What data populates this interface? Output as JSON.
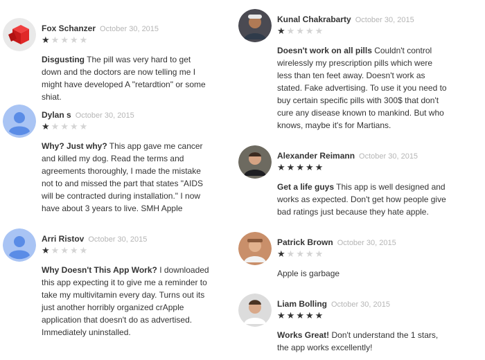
{
  "colors": {
    "star_filled": "#333333",
    "star_empty": "#d4d4d4",
    "date": "#b5b5b5",
    "default_avatar": "#5a8ce6",
    "default_avatar_bg": "#a9c4f4"
  },
  "reviews": [
    {
      "author": "Fox Schanzer",
      "date": "October 30, 2015",
      "rating": 1,
      "title": "Disgusting",
      "text": "The pill was very hard to get down and the doctors are now telling me I might have developed A \"retardtion\" or some shiat.",
      "avatar": "red-cube-avatar"
    },
    {
      "author": "Dylan s",
      "date": "October 30, 2015",
      "rating": 1,
      "title": "Why? Just why?",
      "text": "This app gave me cancer and killed my dog. Read the terms and agreements thoroughly, I made the mistake not to and missed the part that states \"AIDS will be contracted during installation.\" I now have about 3 years to live. SMH Apple",
      "avatar": "default-person-icon"
    },
    {
      "author": "Arri Ristov",
      "date": "October 30, 2015",
      "rating": 1,
      "title": "Why Doesn't This App Work?",
      "text": "I downloaded this app expecting it to give me a reminder to take my multivitamin every day. Turns out its just another horribly organized crApple application that doesn't do as advertised. Immediately uninstalled.",
      "avatar": "default-person-icon"
    },
    {
      "author": "Kunal Chakrabarty",
      "date": "October 30, 2015",
      "rating": 1,
      "title": "Doesn't work on all pills",
      "text": "Couldn't control wirelessly my prescription pills which were less than ten feet away. Doesn't work as stated. Fake advertising. To use it you need to buy certain specific pills with 300$ that don't cure any disease known to mankind. But who knows, maybe it's for Martians.",
      "avatar": "photo-avatar"
    },
    {
      "author": "Alexander Reimann",
      "date": "October 30, 2015",
      "rating": 5,
      "title": "Get a life guys",
      "text": "This app is well designed and works as expected. Don't get how people give bad ratings just because they hate apple.",
      "avatar": "photo-avatar"
    },
    {
      "author": "Patrick Brown",
      "date": "October 30, 2015",
      "rating": 1,
      "title": "",
      "text": "Apple is garbage",
      "avatar": "photo-avatar"
    },
    {
      "author": "Liam Bolling",
      "date": "October 30, 2015",
      "rating": 5,
      "title": "Works Great!",
      "text": "Don't understand the 1 stars, the app works excellently!",
      "avatar": "photo-avatar"
    }
  ]
}
